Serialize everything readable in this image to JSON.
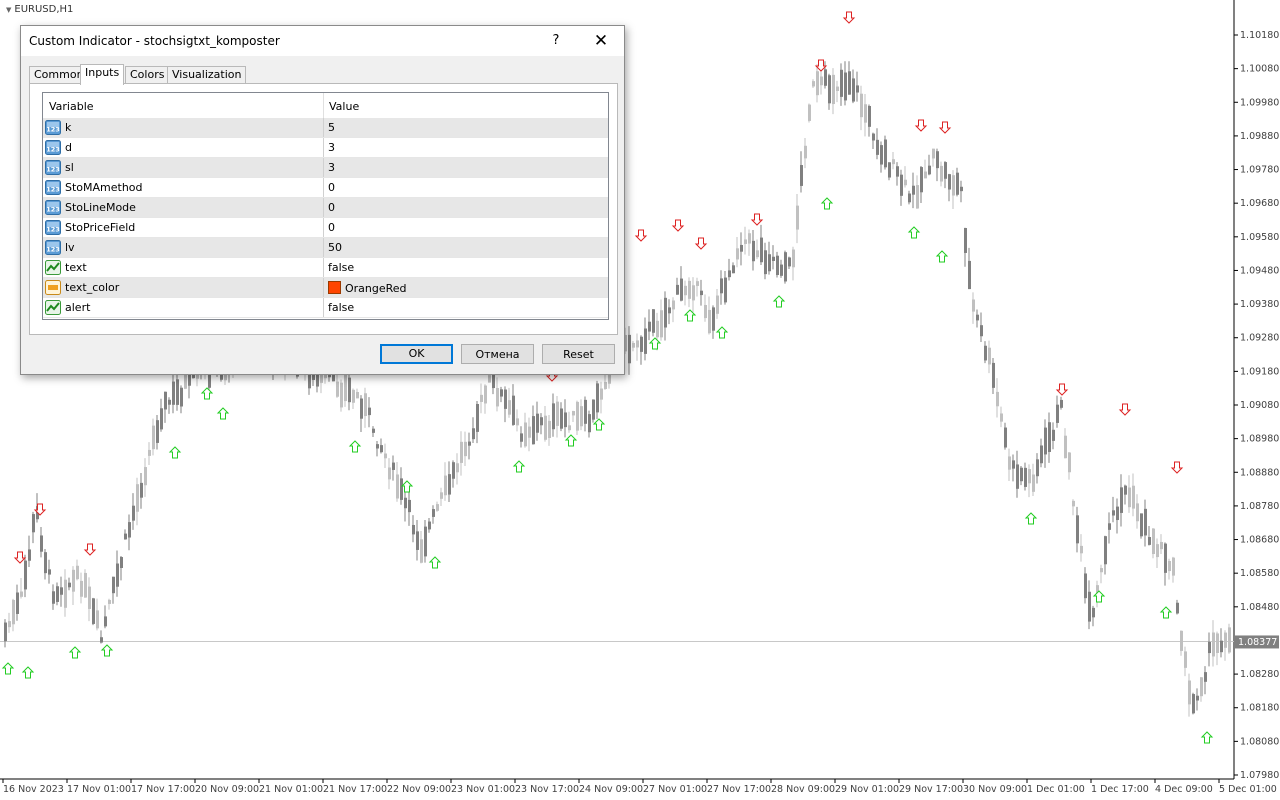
{
  "chart": {
    "symbol": "EURUSD,H1",
    "current_price": "1.08377",
    "price_axis": [
      "1.10180",
      "1.10080",
      "1.09980",
      "1.09880",
      "1.09780",
      "1.09680",
      "1.09580",
      "1.09480",
      "1.09380",
      "1.09280",
      "1.09180",
      "1.09080",
      "1.08980",
      "1.08880",
      "1.08780",
      "1.08680",
      "1.08580",
      "1.08480",
      "1.08280",
      "1.08180",
      "1.08080",
      "1.07980"
    ],
    "time_axis": [
      "16 Nov 2023",
      "17 Nov 01:00",
      "17 Nov 17:00",
      "20 Nov 09:00",
      "21 Nov 01:00",
      "21 Nov 17:00",
      "22 Nov 09:00",
      "23 Nov 01:00",
      "23 Nov 17:00",
      "24 Nov 09:00",
      "27 Nov 01:00",
      "27 Nov 17:00",
      "28 Nov 09:00",
      "29 Nov 01:00",
      "29 Nov 17:00",
      "30 Nov 09:00",
      "1 Dec 01:00",
      "1 Dec 17:00",
      "4 Dec 09:00",
      "5 Dec 01:00"
    ],
    "colors": {
      "up_candle": "#c0c0c0",
      "down_candle": "#808080",
      "buy_arrow": "#22cc22",
      "sell_arrow": "#dd2222",
      "grid_line": "#c8c8c8",
      "axis_text": "#404040"
    }
  },
  "dialog": {
    "title": "Custom Indicator - stochsigtxt_komposter",
    "help_label": "?",
    "close_icon": "✕",
    "tabs": [
      {
        "label": "Common",
        "active": false
      },
      {
        "label": "Inputs",
        "active": true
      },
      {
        "label": "Colors",
        "active": false
      },
      {
        "label": "Visualization",
        "active": false
      }
    ],
    "columns": {
      "variable": "Variable",
      "value": "Value"
    },
    "params": [
      {
        "name": "k",
        "value": "5",
        "icon": "int-icon"
      },
      {
        "name": "d",
        "value": "3",
        "icon": "int-icon"
      },
      {
        "name": "sl",
        "value": "3",
        "icon": "int-icon"
      },
      {
        "name": "StoMAmethod",
        "value": "0",
        "icon": "int-icon"
      },
      {
        "name": "StoLineMode",
        "value": "0",
        "icon": "int-icon"
      },
      {
        "name": "StoPriceField",
        "value": "0",
        "icon": "int-icon"
      },
      {
        "name": "lv",
        "value": "50",
        "icon": "int-icon"
      },
      {
        "name": "text",
        "value": "false",
        "icon": "bool-icon"
      },
      {
        "name": "text_color",
        "value": "OrangeRed",
        "icon": "color-icon",
        "swatch": "#ff4500"
      },
      {
        "name": "alert",
        "value": "false",
        "icon": "bool-icon"
      }
    ],
    "buttons": {
      "ok": "OK",
      "cancel": "Отмена",
      "reset": "Reset"
    }
  }
}
